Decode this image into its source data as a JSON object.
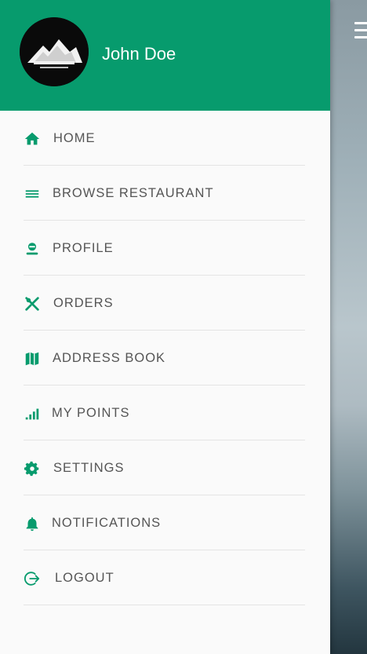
{
  "user": {
    "name": "John Doe"
  },
  "menu": [
    {
      "label": "HOME",
      "icon": "home-icon"
    },
    {
      "label": "BROWSE RESTAURANT",
      "icon": "menu-lines-icon"
    },
    {
      "label": "PROFILE",
      "icon": "person-icon"
    },
    {
      "label": "ORDERS",
      "icon": "utensils-icon"
    },
    {
      "label": "ADDRESS BOOK",
      "icon": "map-icon"
    },
    {
      "label": "MY POINTS",
      "icon": "signal-bars-icon"
    },
    {
      "label": "SETTINGS",
      "icon": "gear-icon"
    },
    {
      "label": "NOTIFICATIONS",
      "icon": "bell-icon"
    },
    {
      "label": "LOGOUT",
      "icon": "logout-icon"
    }
  ],
  "colors": {
    "accent": "#079b6d",
    "text": "#555555",
    "divider": "#e4e4e4"
  }
}
